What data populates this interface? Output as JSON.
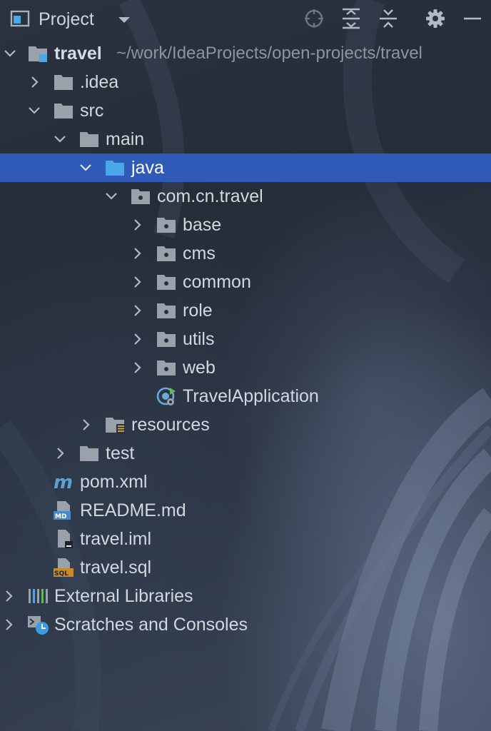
{
  "header": {
    "title": "Project",
    "icons": [
      "project-view-icon",
      "dropdown-arrow-icon",
      "locate-icon",
      "expand-all-icon",
      "collapse-all-icon",
      "settings-gear-icon",
      "hide-minimize-icon"
    ]
  },
  "tree": {
    "root": {
      "label": "travel",
      "path": "~/work/IdeaProjects/open-projects/travel"
    },
    "idea": {
      "label": ".idea"
    },
    "src": {
      "label": "src"
    },
    "main": {
      "label": "main"
    },
    "java": {
      "label": "java"
    },
    "package": {
      "label": "com.cn.travel"
    },
    "packages": [
      {
        "label": "base"
      },
      {
        "label": "cms"
      },
      {
        "label": "common"
      },
      {
        "label": "role"
      },
      {
        "label": "utils"
      },
      {
        "label": "web"
      }
    ],
    "app_class": {
      "label": "TravelApplication"
    },
    "resources": {
      "label": "resources"
    },
    "test": {
      "label": "test"
    },
    "files": [
      {
        "label": "pom.xml",
        "icon": "maven-icon"
      },
      {
        "label": "README.md",
        "icon": "markdown-file-icon"
      },
      {
        "label": "travel.iml",
        "icon": "iml-file-icon"
      },
      {
        "label": "travel.sql",
        "icon": "sql-file-icon"
      }
    ],
    "external_libraries": {
      "label": "External Libraries"
    },
    "scratches": {
      "label": "Scratches and Consoles"
    }
  },
  "colors": {
    "selection": "#2f5ab8",
    "folder": "#9aa1ab",
    "java_folder": "#4aa8e8",
    "text": "#d3d7de",
    "path_text": "#8e949c"
  }
}
